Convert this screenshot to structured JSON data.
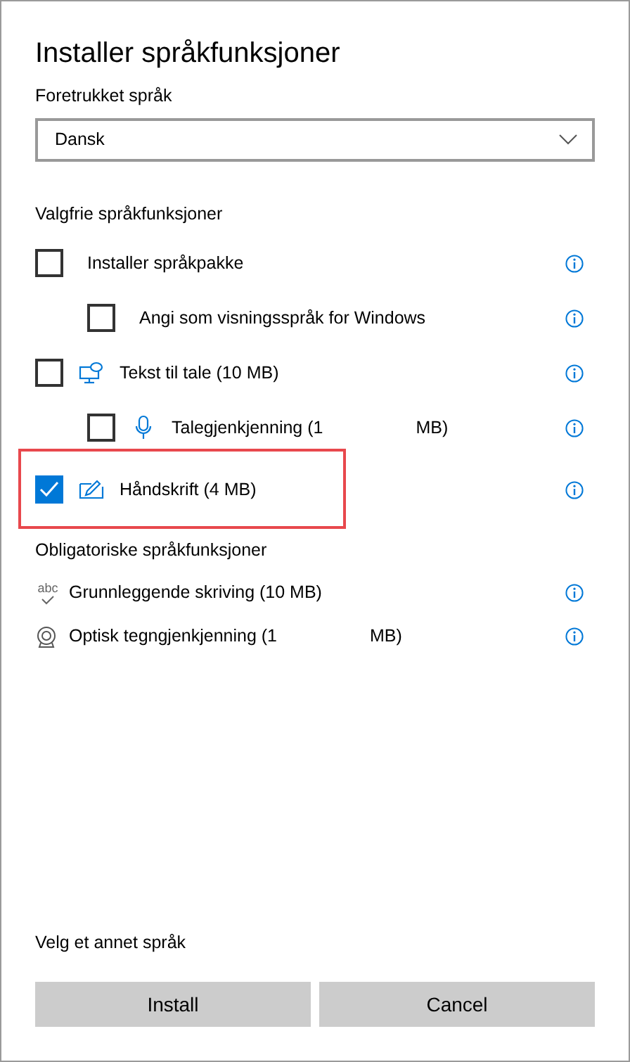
{
  "title": "Installer språkfunksjoner",
  "preferred": {
    "label": "Foretrukket språk",
    "value": "Dansk"
  },
  "optional": {
    "heading": "Valgfrie språkfunksjoner",
    "items": [
      {
        "label": "Installer språkpakke",
        "checked": false,
        "indented": false,
        "kind": "plain",
        "highlighted": false
      },
      {
        "label": "Angi som visningsspråk for Windows",
        "checked": false,
        "indented": true,
        "kind": "plain",
        "highlighted": false
      },
      {
        "label": "Tekst til tale (10 MB)",
        "checked": false,
        "indented": false,
        "kind": "speech",
        "highlighted": false
      },
      {
        "label": "Talegjenkjenning (1",
        "label_tail": "MB)",
        "checked": false,
        "indented": true,
        "kind": "microphone",
        "highlighted": false
      },
      {
        "label": "Håndskrift (4 MB)",
        "checked": true,
        "indented": false,
        "kind": "pen",
        "highlighted": true
      }
    ]
  },
  "required": {
    "heading": "Obligatoriske språkfunksjoner",
    "items": [
      {
        "label": "Grunnleggende skriving (10 MB)",
        "kind": "spelling",
        "icon_text": "abc"
      },
      {
        "label": "Optisk tegngjenkjenning (1",
        "label_tail": "MB)",
        "kind": "camera"
      }
    ]
  },
  "link": "Velg et annet språk",
  "buttons": [
    "Install",
    "Cancel"
  ]
}
